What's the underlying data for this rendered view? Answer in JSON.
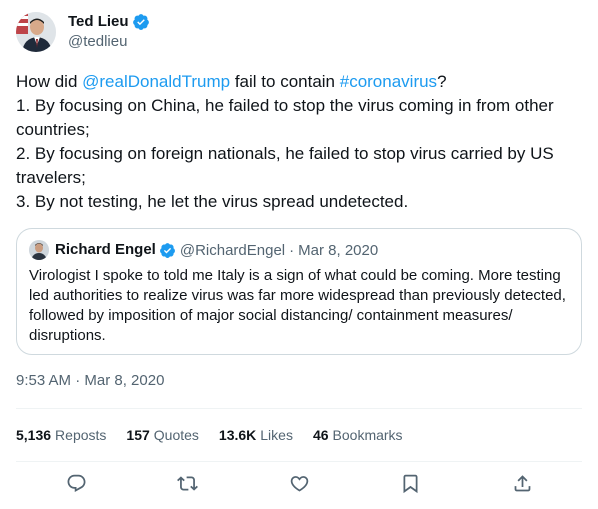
{
  "author": {
    "display_name": "Ted Lieu",
    "handle": "@tedlieu"
  },
  "tweet": {
    "line1_prefix": "How did ",
    "mention": "@realDonaldTrump",
    "line1_mid": " fail to contain ",
    "hashtag": "#coronavirus",
    "line1_suffix": "?",
    "line2": "1. By focusing on China, he failed to stop the virus coming in from other countries;",
    "line3": "2. By focusing on foreign nationals, he failed to stop virus carried by US travelers;",
    "line4": "3. By not testing, he let the virus spread undetected."
  },
  "quoted": {
    "display_name": "Richard Engel",
    "handle": "@RichardEngel",
    "separator": "·",
    "date": "Mar 8, 2020",
    "text": "Virologist I spoke to told me Italy is a sign of what could be coming. More testing led authorities to realize virus was far more widespread than previously detected, followed by imposition of major social distancing/ containment measures/ disruptions."
  },
  "timestamp": "9:53 AM · Mar 8, 2020",
  "stats": {
    "reposts_count": "5,136",
    "reposts_label": "Reposts",
    "quotes_count": "157",
    "quotes_label": "Quotes",
    "likes_count": "13.6K",
    "likes_label": "Likes",
    "bookmarks_count": "46",
    "bookmarks_label": "Bookmarks"
  },
  "actions": [
    "reply-icon",
    "repost-icon",
    "like-icon",
    "bookmark-icon",
    "share-icon"
  ],
  "colors": {
    "link": "#1d9bf0",
    "verified": "#1d9bf0",
    "secondary_text": "#536471",
    "border": "#cfd9de"
  }
}
